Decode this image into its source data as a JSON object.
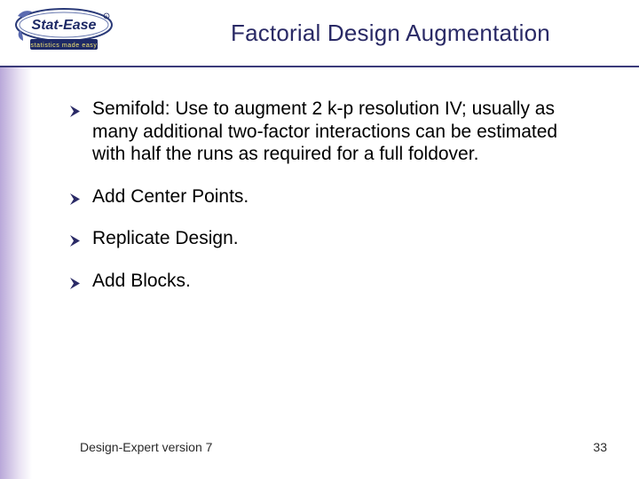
{
  "header": {
    "title": "Factorial Design Augmentation",
    "logo_primary": "Stat-Ease",
    "logo_tagline": "statistics made easy"
  },
  "bullets": [
    "Semifold: Use to augment 2 k-p resolution IV; usually as many additional two-factor interactions can be estimated with half the runs as required for a full foldover.",
    "Add Center Points.",
    "Replicate Design.",
    "Add Blocks."
  ],
  "footer": {
    "left": "Design-Expert version 7",
    "page": "33"
  },
  "colors": {
    "title": "#2a2a66",
    "rule": "#3b3b7a",
    "gradient_start": "#b9a8d9"
  }
}
